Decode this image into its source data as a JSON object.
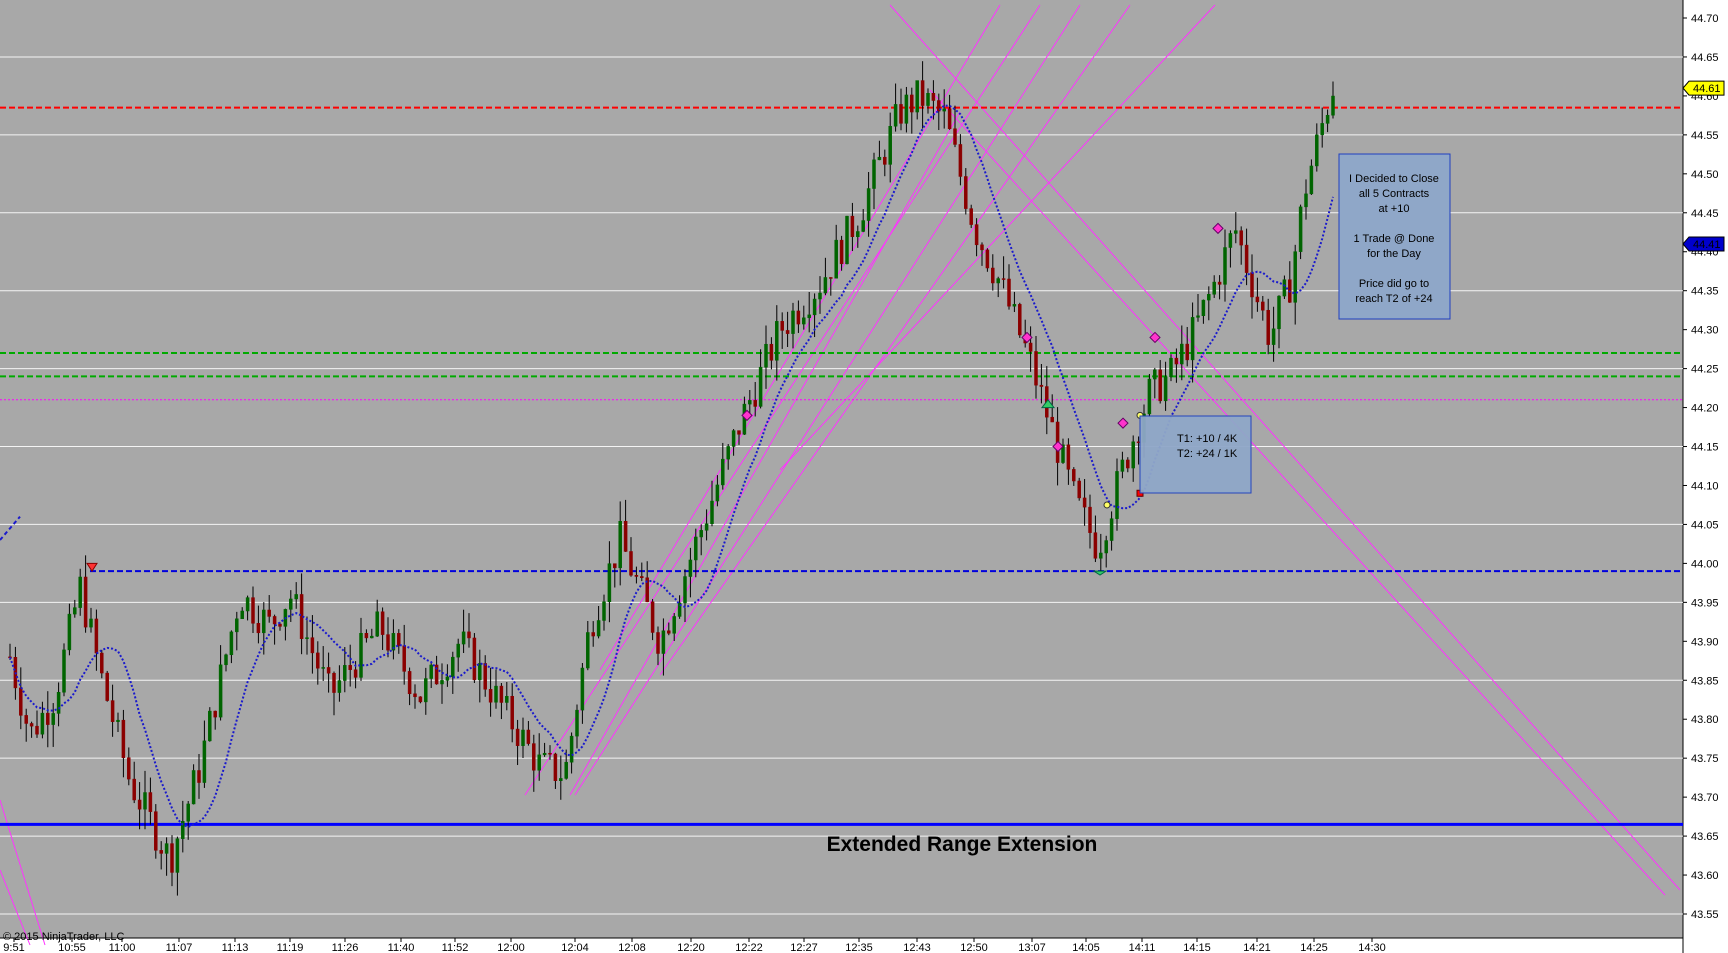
{
  "chart_data": {
    "type": "candlestick",
    "platform_text": "© 2015 NinjaTrader, LLC",
    "ylim": [
      43.52,
      44.72
    ],
    "y_ticks": [
      "44.70",
      "44.65",
      "44.60",
      "44.55",
      "44.50",
      "44.45",
      "44.40",
      "44.35",
      "44.30",
      "44.25",
      "44.20",
      "44.15",
      "44.10",
      "44.05",
      "44.00",
      "43.95",
      "43.90",
      "43.85",
      "43.80",
      "43.75",
      "43.70",
      "43.65",
      "43.60",
      "43.55"
    ],
    "x_tick_labels": [
      "9:51",
      "10:55",
      "11:00",
      "11:07",
      "11:13",
      "11:19",
      "11:26",
      "11:40",
      "11:52",
      "12:00",
      "12:04",
      "12:08",
      "12:20",
      "12:22",
      "12:27",
      "12:35",
      "12:43",
      "12:50",
      "13:07",
      "14:05",
      "14:11",
      "14:15",
      "14:21",
      "14:25",
      "14:30"
    ],
    "last_price_marker": {
      "label": "44.61",
      "value": 44.61,
      "color": "#ffff00"
    },
    "ma_marker": {
      "label": "44.41",
      "value": 44.41,
      "color": "#0000cc"
    },
    "horizontal_lines": [
      {
        "value": 44.585,
        "color": "#ff0000",
        "style": "dashed"
      },
      {
        "value": 44.27,
        "color": "#00aa00",
        "style": "dashed"
      },
      {
        "value": 44.24,
        "color": "#00aa00",
        "style": "dashed"
      },
      {
        "value": 44.21,
        "color": "#ff00ff",
        "style": "dotted"
      },
      {
        "value": 43.99,
        "color": "#0000dd",
        "style": "dashed"
      },
      {
        "value": 43.665,
        "color": "#0000ff",
        "style": "solid"
      }
    ],
    "annotations": {
      "decision_note": [
        "I Decided to Close",
        "all 5 Contracts",
        "at +10",
        "",
        "1 Trade @ Done",
        "for the Day",
        "",
        "Price did go to",
        "reach T2 of +24"
      ],
      "targets_note": [
        "T1: +10  /  4K",
        "T2: +24  /  1K"
      ],
      "range_label": "Extended Range Extension"
    },
    "up_color": "#006400",
    "down_color": "#8b0000",
    "ma_color": "#1a1acc",
    "channel_color": "#ff33ff"
  }
}
